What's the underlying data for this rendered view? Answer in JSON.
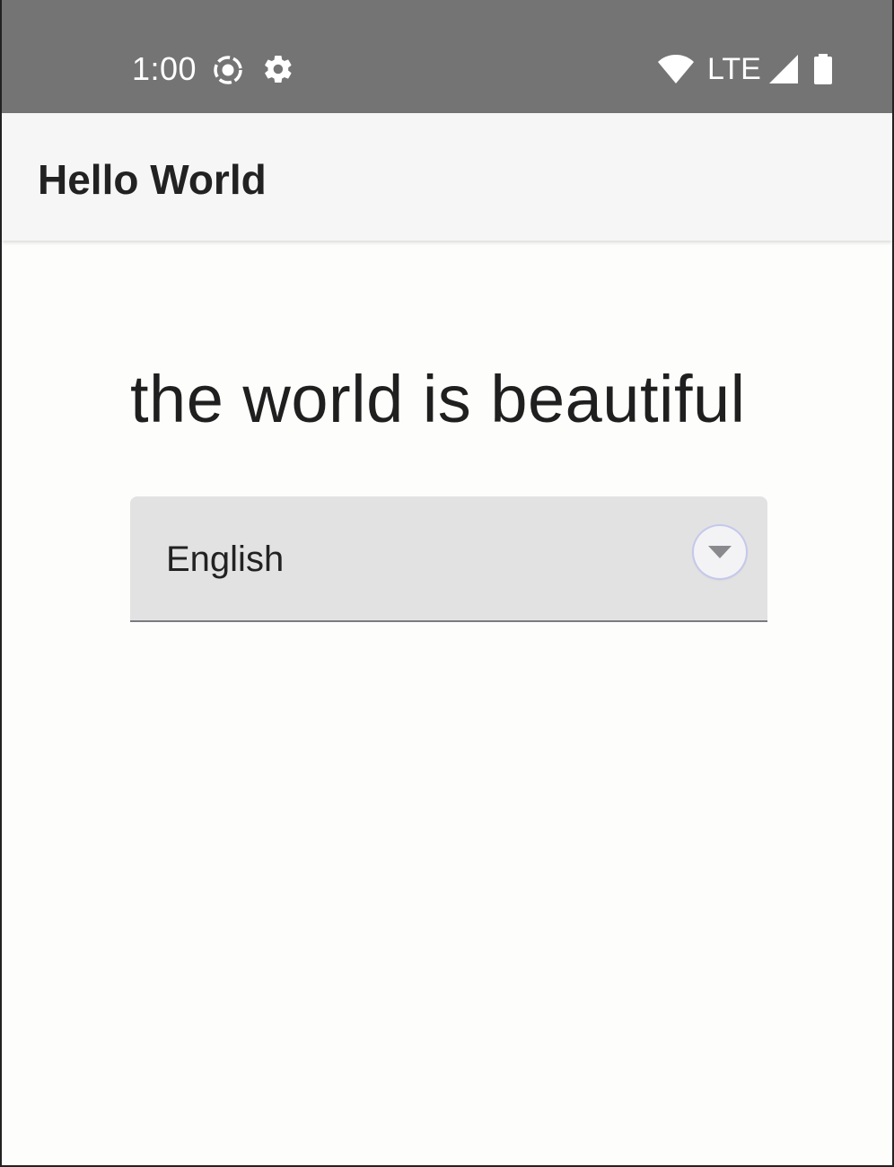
{
  "status_bar": {
    "time": "1:00",
    "network": "LTE",
    "icons": [
      "screen-record-icon",
      "gear-icon",
      "wifi-icon",
      "signal-icon",
      "battery-icon"
    ]
  },
  "app_bar": {
    "title": "Hello World"
  },
  "main": {
    "headline": "the world is beautiful",
    "language_select": {
      "selected_value": "English",
      "icon": "chevron-down-icon"
    }
  },
  "colors": {
    "status_bar_bg": "#747474",
    "app_bar_bg": "#f6f6f7",
    "select_bg": "#e2e2e3",
    "text": "#222222"
  }
}
